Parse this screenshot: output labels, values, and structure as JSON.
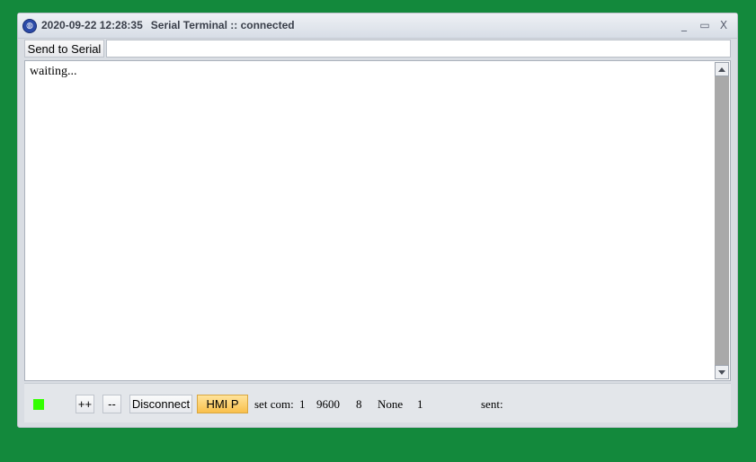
{
  "window": {
    "datetime": "2020-09-22 12:28:35",
    "title": "Serial Terminal :: connected",
    "icon": "app-logo-icon",
    "controls": {
      "minimize": "_",
      "maximize": "▭",
      "close": "X"
    }
  },
  "send": {
    "button_label": "Send to Serial",
    "input_value": ""
  },
  "output": {
    "text": "waiting..."
  },
  "statusbar": {
    "indicator_color": "#33ff00",
    "plus_label": "++",
    "minus_label": "--",
    "disconnect_label": "Disconnect",
    "hmi_label": "HMI P",
    "set_com_label": "set com:",
    "com_port": "1",
    "baud": "9600",
    "data_bits": "8",
    "parity": "None",
    "stop_bits": "1",
    "sent_label": "sent:"
  }
}
